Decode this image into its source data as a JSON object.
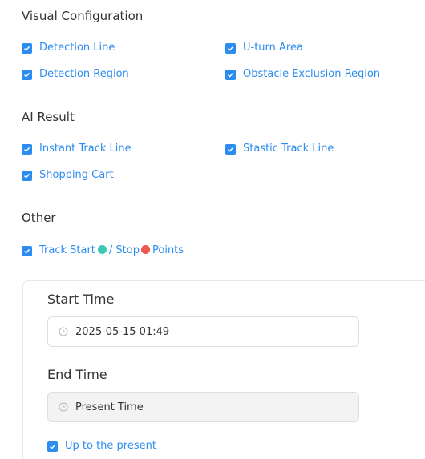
{
  "colors": {
    "accent": "#2d8cf0",
    "start_dot": "#3cc8b4",
    "stop_dot": "#f0554f"
  },
  "visual_config": {
    "title": "Visual Configuration",
    "items": [
      {
        "label": "Detection Line",
        "checked": true
      },
      {
        "label": "U-turn Area",
        "checked": true
      },
      {
        "label": "Detection Region",
        "checked": true
      },
      {
        "label": "Obstacle Exclusion Region",
        "checked": true
      }
    ]
  },
  "ai_result": {
    "title": "AI Result",
    "items": [
      {
        "label": "Instant Track Line",
        "checked": true
      },
      {
        "label": "Stastic Track Line",
        "checked": true
      },
      {
        "label": "Shopping Cart",
        "checked": true
      }
    ]
  },
  "other": {
    "title": "Other",
    "track_points": {
      "checked": true,
      "label_start": "Track Start",
      "label_sep": "/ Stop",
      "label_end": "Points"
    }
  },
  "time_panel": {
    "start_title": "Start Time",
    "start_value": "2025-05-15 01:49",
    "end_title": "End Time",
    "end_value": "Present Time",
    "present_label": "Up to the present",
    "present_checked": true
  }
}
